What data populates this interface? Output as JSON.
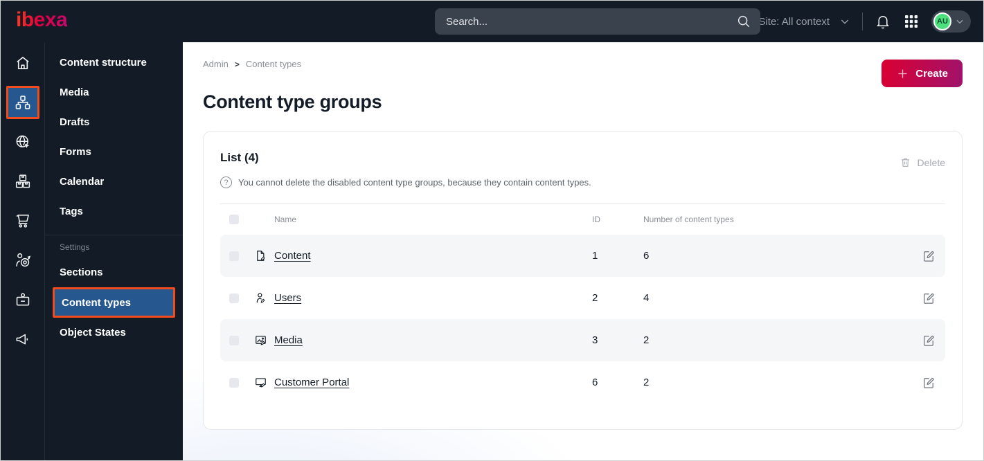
{
  "topbar": {
    "logo": "ibexa",
    "search": {
      "placeholder": "Search..."
    },
    "site_selector": "Site: All context",
    "avatar_initials": "AU"
  },
  "icon_rail": {
    "items": [
      "home",
      "content-structure",
      "site",
      "product-catalog",
      "commerce",
      "personalization",
      "admin",
      "marketing"
    ],
    "active": "content-structure"
  },
  "sidebar": {
    "items": [
      {
        "label": "Content structure"
      },
      {
        "label": "Media"
      },
      {
        "label": "Drafts"
      },
      {
        "label": "Forms"
      },
      {
        "label": "Calendar"
      },
      {
        "label": "Tags"
      }
    ],
    "settings_heading": "Settings",
    "settings_items": [
      {
        "label": "Sections"
      },
      {
        "label": "Content types",
        "active": true
      },
      {
        "label": "Object States"
      }
    ]
  },
  "main": {
    "breadcrumb": {
      "root": "Admin",
      "current": "Content types"
    },
    "create_button": "Create",
    "page_title": "Content type groups",
    "list_card": {
      "title": "List (4)",
      "delete_button": "Delete",
      "info": "You cannot delete the disabled content type groups, because they contain content types.",
      "columns": {
        "name": "Name",
        "id": "ID",
        "count": "Number of content types"
      },
      "rows": [
        {
          "icon": "content-file-icon",
          "name": "Content",
          "id": "1",
          "count": "6"
        },
        {
          "icon": "users-icon",
          "name": "Users",
          "id": "2",
          "count": "4"
        },
        {
          "icon": "media-image-icon",
          "name": "Media",
          "id": "3",
          "count": "2"
        },
        {
          "icon": "customer-portal-monitor-icon",
          "name": "Customer Portal",
          "id": "6",
          "count": "2"
        }
      ]
    }
  },
  "colors": {
    "topbar_bg": "#131c26",
    "accent_red": "#db0032",
    "accent_magenta": "#a0136c",
    "highlight_orange": "#f04c1e",
    "selected_blue": "#26578e",
    "row_alt_bg": "#f5f6f8",
    "avatar_green": "#4ce07f"
  }
}
